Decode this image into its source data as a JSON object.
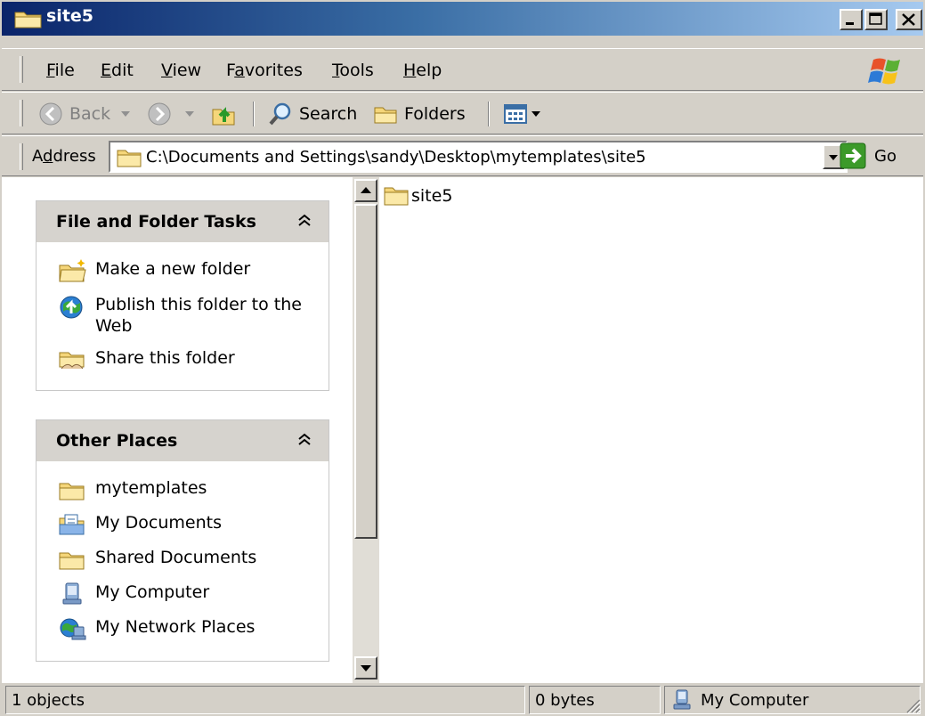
{
  "window": {
    "title": "site5"
  },
  "menubar": {
    "items": [
      {
        "label": "File",
        "accel": "F",
        "rest": "ile"
      },
      {
        "label": "Edit",
        "accel": "E",
        "rest": "dit"
      },
      {
        "label": "View",
        "accel": "V",
        "rest": "iew"
      },
      {
        "label": "Favorites",
        "pre": "F",
        "accel": "a",
        "rest": "vorites"
      },
      {
        "label": "Tools",
        "accel": "T",
        "rest": "ools"
      },
      {
        "label": "Help",
        "accel": "H",
        "rest": "elp"
      }
    ]
  },
  "toolbar": {
    "back_label": "Back",
    "search_label": "Search",
    "folders_label": "Folders"
  },
  "address": {
    "label_pre": "A",
    "label_accel": "d",
    "label_rest": "dress",
    "value": "C:\\Documents and Settings\\sandy\\Desktop\\mytemplates\\site5",
    "go_label": "Go"
  },
  "tasks_panel": {
    "title": "File and Folder Tasks",
    "items": [
      {
        "label": "Make a new folder",
        "icon": "new-folder-icon"
      },
      {
        "label_line1": "Publish this folder to the",
        "label_line2": "Web",
        "icon": "publish-web-icon"
      },
      {
        "label": "Share this folder",
        "icon": "share-folder-icon"
      }
    ]
  },
  "places_panel": {
    "title": "Other Places",
    "items": [
      {
        "label": "mytemplates",
        "icon": "folder-icon"
      },
      {
        "label": "My Documents",
        "icon": "my-documents-icon"
      },
      {
        "label": "Shared Documents",
        "icon": "folder-icon"
      },
      {
        "label": "My Computer",
        "icon": "my-computer-icon"
      },
      {
        "label": "My Network Places",
        "icon": "network-places-icon"
      }
    ]
  },
  "files": [
    {
      "name": "site5",
      "icon": "folder-icon"
    }
  ],
  "statusbar": {
    "objects": "1 objects",
    "size": "0 bytes",
    "zone": "My Computer"
  },
  "colors": {
    "title_gradient_start": "#0a246a",
    "title_gradient_end": "#a6caf0",
    "face": "#d4d0c8",
    "panel_header": "#d6d3ce",
    "folder_yellow": "#f5d67a"
  }
}
